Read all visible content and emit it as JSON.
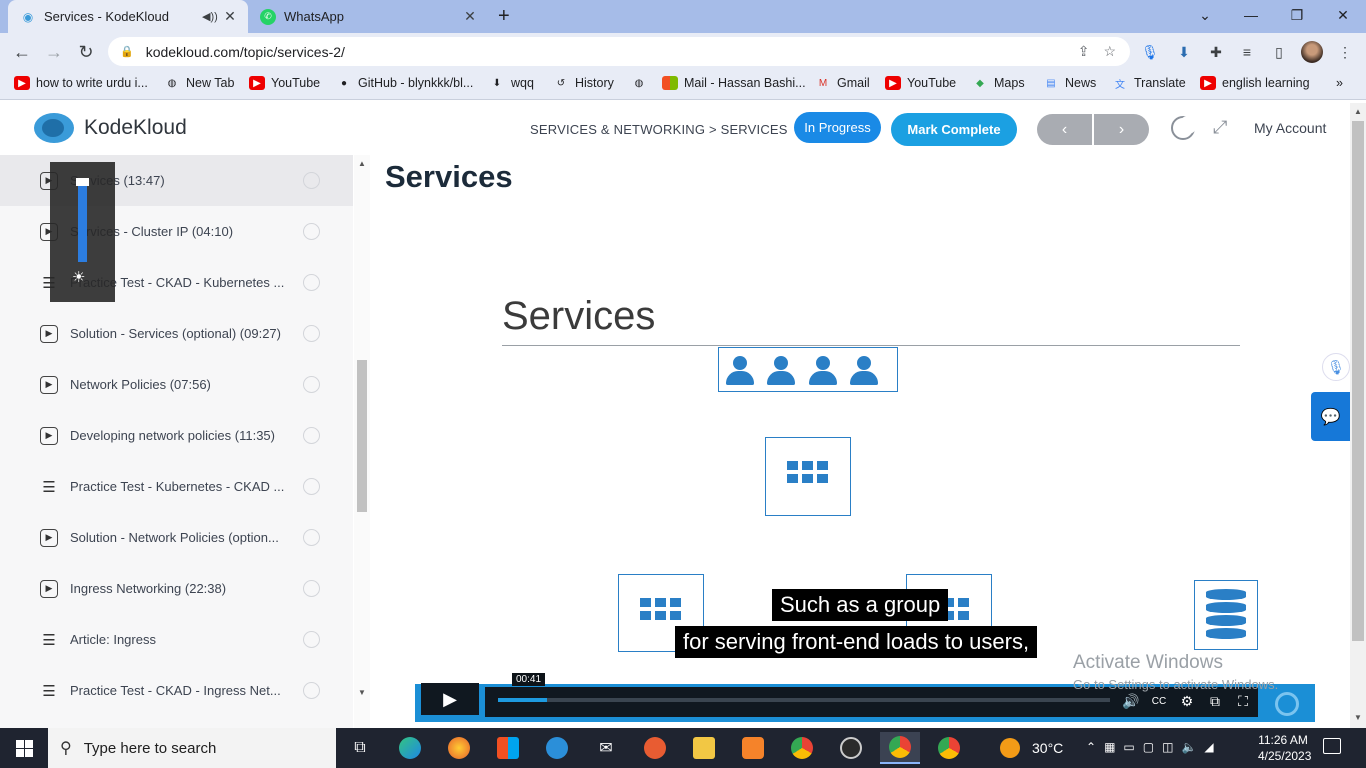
{
  "browser": {
    "tabs": [
      {
        "label": "Services - KodeKloud",
        "active": true
      },
      {
        "label": "WhatsApp",
        "active": false
      }
    ],
    "url": "kodekloud.com/topic/services-2/",
    "bookmarks": [
      "how to write urdu i...",
      "New Tab",
      "YouTube",
      "GitHub - blynkkk/bl...",
      "wqq",
      "History",
      "Mail - Hassan Bashi...",
      "Gmail",
      "YouTube",
      "Maps",
      "News",
      "Translate",
      "english learning"
    ]
  },
  "header": {
    "logo": "KodeKloud",
    "breadcrumb": "SERVICES & NETWORKING > SERVICES",
    "status": "In Progress",
    "complete": "Mark Complete",
    "prev": "‹",
    "next": "›",
    "account": "My Account"
  },
  "sidebar": {
    "items": [
      {
        "label": "Services (13:47)",
        "type": "video",
        "current": true
      },
      {
        "label": "Services - Cluster IP (04:10)",
        "type": "video"
      },
      {
        "label": "Practice Test - CKAD - Kubernetes ...",
        "type": "doc"
      },
      {
        "label": "Solution - Services (optional) (09:27)",
        "type": "video"
      },
      {
        "label": "Network Policies (07:56)",
        "type": "video"
      },
      {
        "label": "Developing network policies (11:35)",
        "type": "video"
      },
      {
        "label": "Practice Test - Kubernetes - CKAD ...",
        "type": "doc"
      },
      {
        "label": "Solution - Network Policies (option...",
        "type": "video"
      },
      {
        "label": "Ingress Networking (22:38)",
        "type": "video"
      },
      {
        "label": "Article: Ingress",
        "type": "doc"
      },
      {
        "label": "Practice Test - CKAD - Ingress Net...",
        "type": "doc"
      }
    ]
  },
  "main": {
    "title": "Services",
    "slide_title": "Services",
    "subtitles": [
      "Such as a group",
      "for serving front-end loads to users,"
    ],
    "video_time": "00:41",
    "progress_fraction": 0.08
  },
  "watermark": {
    "line1": "Activate Windows",
    "line2": "Go to Settings to activate Windows."
  },
  "taskbar": {
    "search_placeholder": "Type here to search",
    "weather": "30°C",
    "time": "11:26 AM",
    "date": "4/25/2023"
  },
  "colors": {
    "accent": "#1ba0e2",
    "slide_blue": "#2a7fc6",
    "tabstrip": "#a6bce8"
  }
}
